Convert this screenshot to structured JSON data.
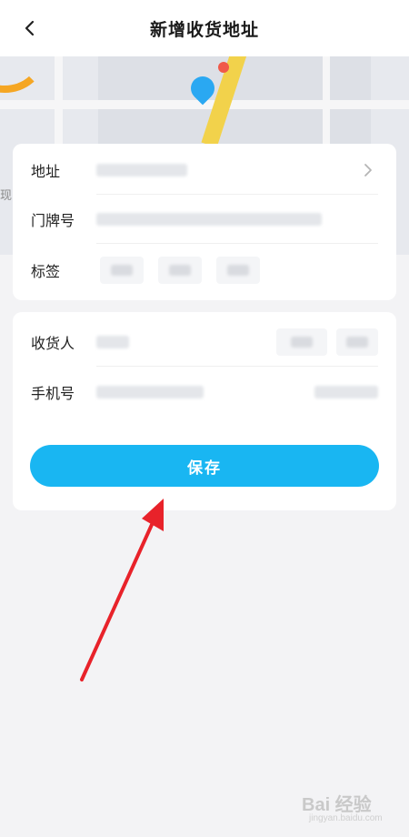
{
  "header": {
    "title": "新增收货地址",
    "back_icon": "chevron-left-icon"
  },
  "map": {
    "edge_text": "现"
  },
  "address_card": {
    "address_label": "地址",
    "door_label": "门牌号",
    "tag_label": "标签"
  },
  "contact_card": {
    "receiver_label": "收货人",
    "phone_label": "手机号",
    "save_label": "保存"
  },
  "watermark": {
    "text": "Bai  经验",
    "sub": "jingyan.baidu.com"
  },
  "colors": {
    "accent": "#19b6f2",
    "annotation_arrow": "#e8222a"
  }
}
